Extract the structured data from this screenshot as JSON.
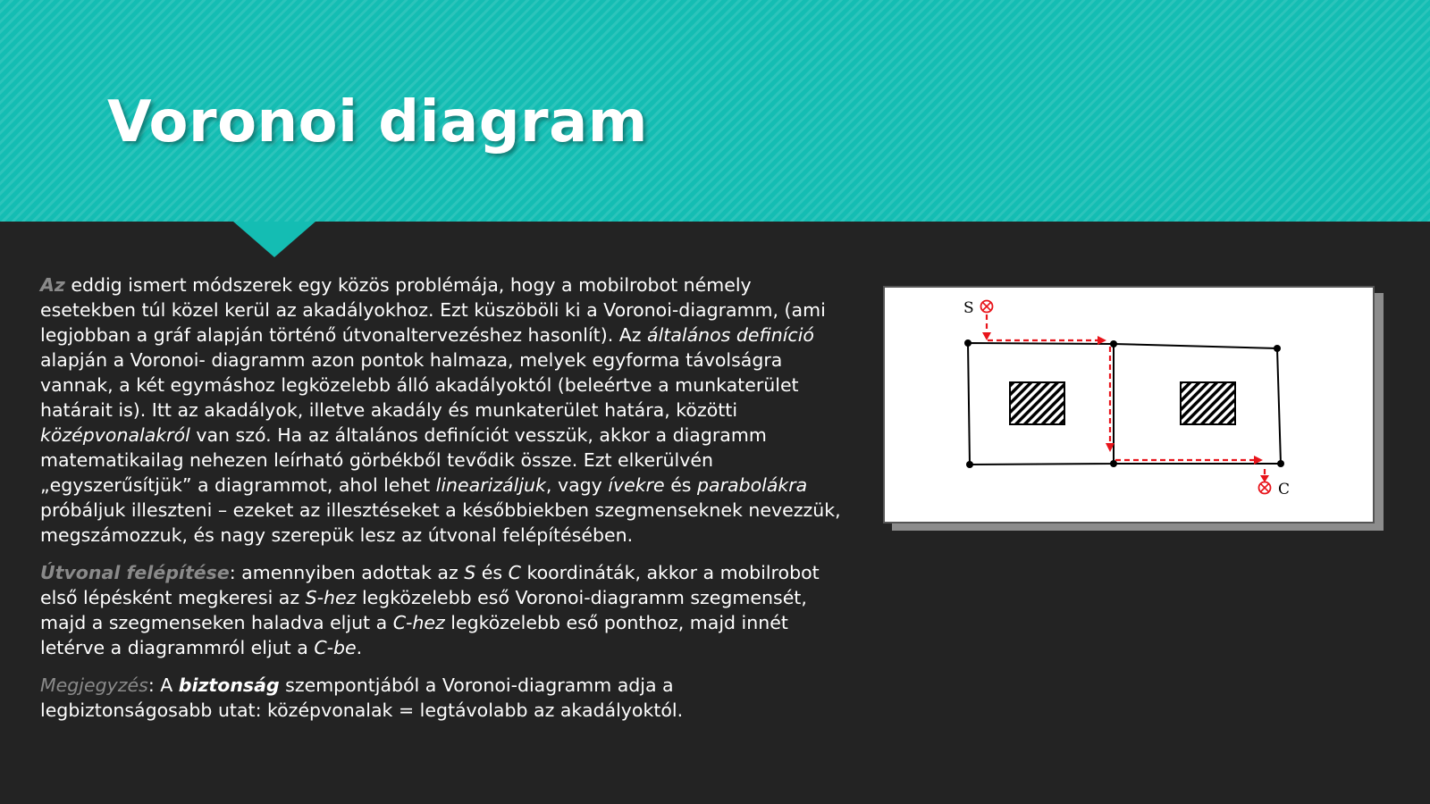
{
  "slide": {
    "title": "Voronoi diagram"
  },
  "paragraphs": [
    {
      "segments": [
        {
          "text": "Az",
          "style": "lead"
        },
        {
          "text": " eddig ismert módszerek egy közös problémája, hogy a mobilrobot némely esetekben túl közel kerül az akadályokhoz. Ezt küszöböli ki a Voronoi-diagramm, (ami legjobban a gráf alapján történő útvonaltervezéshez hasonlít). Az ",
          "style": "normal"
        },
        {
          "text": "általános definíció",
          "style": "italic"
        },
        {
          "text": " alapján a Voronoi- diagramm azon pontok halmaza, melyek egyforma távolságra vannak, a két egymáshoz legközelebb álló akadályoktól (beleértve a munkaterület határait is). Itt az akadályok, illetve akadály és munkaterület határa, közötti ",
          "style": "normal"
        },
        {
          "text": "középvonalakról",
          "style": "italic"
        },
        {
          "text": " van szó. Ha az általános definíciót vesszük, akkor a diagramm matematikailag nehezen leírható görbékből tevődik össze. Ezt elkerülvén „egyszerűsítjük” a diagrammot, ahol lehet ",
          "style": "normal"
        },
        {
          "text": "linearizáljuk",
          "style": "italic"
        },
        {
          "text": ", vagy ",
          "style": "normal"
        },
        {
          "text": "ívekre",
          "style": "italic"
        },
        {
          "text": " és ",
          "style": "normal"
        },
        {
          "text": "parabolákra",
          "style": "italic"
        },
        {
          "text": " próbáljuk illeszteni – ezeket az illesztéseket a későbbiekben szegmenseknek nevezzük, megszámozzuk, és nagy szerepük lesz az útvonal felépítésében.",
          "style": "normal"
        }
      ]
    },
    {
      "segments": [
        {
          "text": "Útvonal felépítése",
          "style": "lead"
        },
        {
          "text": ": amennyiben adottak az ",
          "style": "normal"
        },
        {
          "text": "S",
          "style": "italic"
        },
        {
          "text": " és ",
          "style": "normal"
        },
        {
          "text": "C",
          "style": "italic"
        },
        {
          "text": " koordináták, akkor a mobilrobot első lépésként megkeresi az ",
          "style": "normal"
        },
        {
          "text": "S-hez",
          "style": "italic"
        },
        {
          "text": " legközelebb eső Voronoi-diagramm szegmensét, majd a szegmenseken haladva eljut a ",
          "style": "normal"
        },
        {
          "text": "C-hez",
          "style": "italic"
        },
        {
          "text": " legközelebb eső ponthoz, majd innét letérve a diagrammról eljut a ",
          "style": "normal"
        },
        {
          "text": "C-be",
          "style": "italic"
        },
        {
          "text": ".",
          "style": "normal"
        }
      ]
    },
    {
      "segments": [
        {
          "text": "Megjegyzés",
          "style": "lead-plain"
        },
        {
          "text": ": A ",
          "style": "normal"
        },
        {
          "text": "biztonság",
          "style": "bold-italic"
        },
        {
          "text": " szempontjából a Voronoi-diagramm adja a legbiztonságosabb utat: középvonalak = legtávolabb az akadályoktól.",
          "style": "normal"
        }
      ]
    }
  ],
  "figure": {
    "start_label": "S",
    "goal_label": "C",
    "path_color": "#e8141b",
    "edge_color": "#000000"
  }
}
